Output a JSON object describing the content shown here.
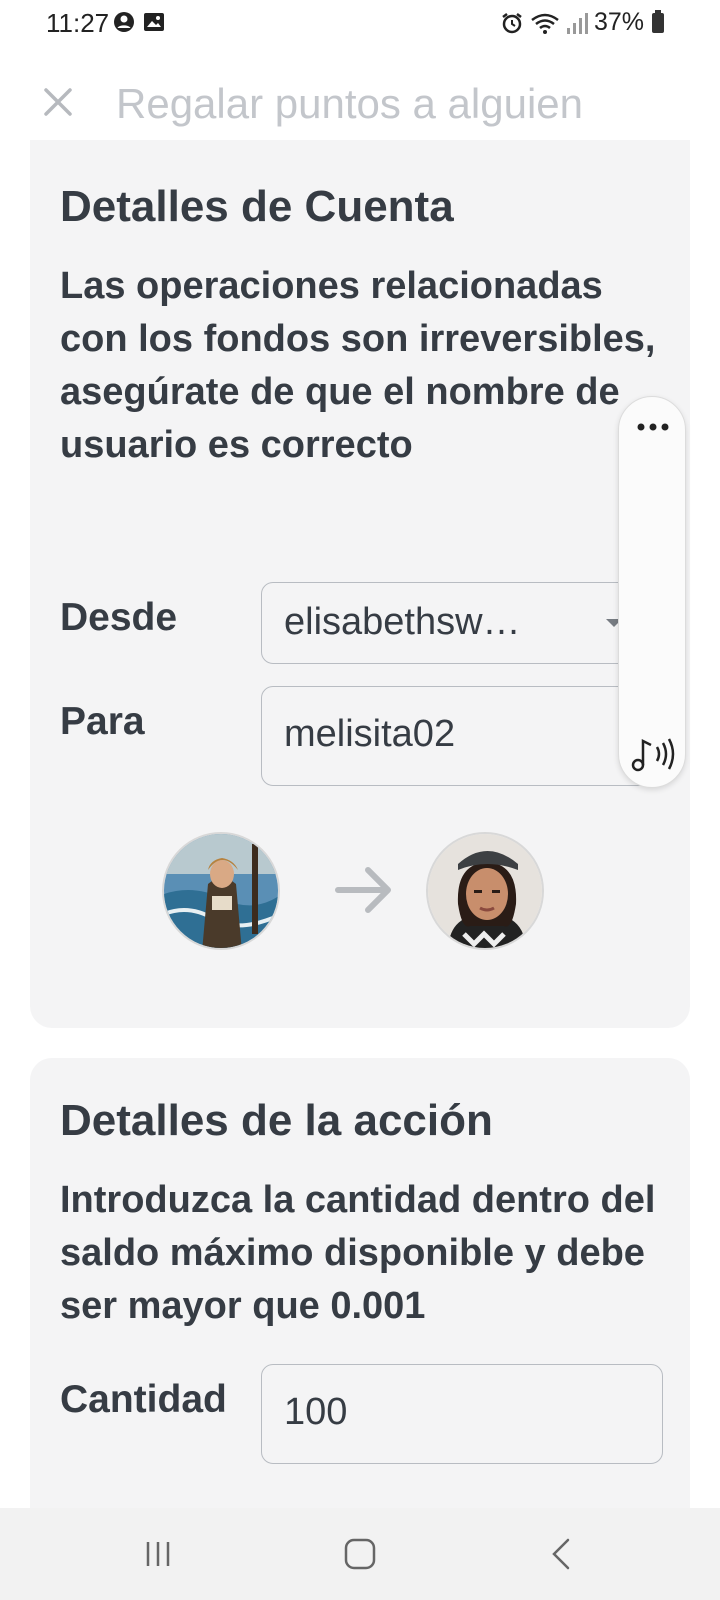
{
  "status_bar": {
    "time": "11:27",
    "battery": "37%"
  },
  "header": {
    "title": "Regalar puntos a alguien",
    "close_icon": "close-icon"
  },
  "account_card": {
    "title": "Detalles de Cuenta",
    "description": "Las operaciones relacionadas con los fondos son irreversibles, asegúrate de que el nombre de usuario es correcto",
    "from_label": "Desde",
    "from_value": "elisabethsw…",
    "to_label": "Para",
    "to_value": "melisita02"
  },
  "action_card": {
    "title": "Detalles de la acción",
    "description": "Introduzca la cantidad dentro del saldo máximo disponible y debe ser mayor que 0.001",
    "amount_label": "Cantidad",
    "amount_value": "100"
  },
  "floating_panel": {
    "more_icon": "more-horizontal-icon",
    "audio_icon": "audio-music-icon"
  },
  "nav_bar": {
    "recents_icon": "recents-icon",
    "home_icon": "home-icon",
    "back_icon": "back-icon"
  },
  "colors": {
    "text": "#363c44",
    "title_muted": "#c3c6cb",
    "card_bg": "#f4f4f5",
    "border": "#b8bcc2"
  }
}
